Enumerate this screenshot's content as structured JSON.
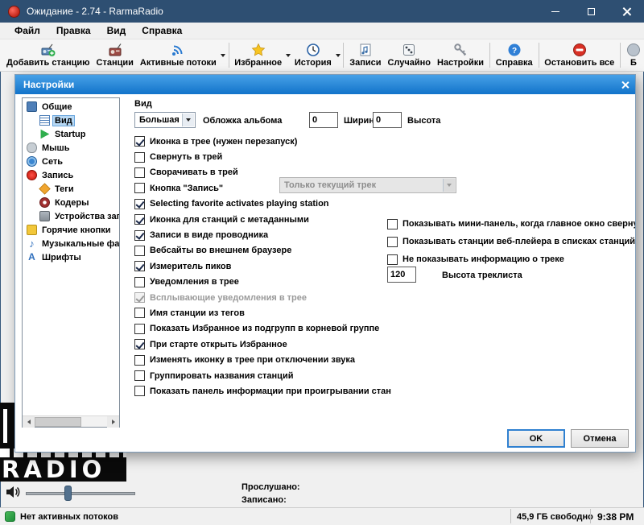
{
  "window": {
    "title": "Ожидание - 2.74 - RarmaRadio",
    "menu": [
      "Файл",
      "Правка",
      "Вид",
      "Справка"
    ],
    "toolbar_groups": [
      [
        {
          "icon": "add-station",
          "label": "Добавить станцию"
        },
        {
          "icon": "stations",
          "label": "Станции"
        },
        {
          "icon": "active-streams",
          "label": "Активные потоки",
          "dropdown": true
        }
      ],
      [
        {
          "icon": "favorites",
          "label": "Избранное",
          "dropdown": true
        },
        {
          "icon": "history",
          "label": "История",
          "dropdown": true
        }
      ],
      [
        {
          "icon": "recordings",
          "label": "Записи"
        },
        {
          "icon": "random",
          "label": "Случайно"
        },
        {
          "icon": "settings",
          "label": "Настройки"
        }
      ],
      [
        {
          "icon": "help",
          "label": "Справка"
        }
      ],
      [
        {
          "icon": "stop-all",
          "label": "Остановить все"
        }
      ],
      [
        {
          "icon": "blocked",
          "label": "Б"
        }
      ]
    ]
  },
  "dialog": {
    "title": "Настройки",
    "tree": [
      {
        "icon": "general",
        "label": "Общие",
        "level": 0
      },
      {
        "icon": "view",
        "label": "Вид",
        "level": 1,
        "selected": true
      },
      {
        "icon": "startup",
        "label": "Startup",
        "level": 1
      },
      {
        "icon": "mouse",
        "label": "Мышь",
        "level": 0
      },
      {
        "icon": "network",
        "label": "Сеть",
        "level": 0
      },
      {
        "icon": "record",
        "label": "Запись",
        "level": 0
      },
      {
        "icon": "tags",
        "label": "Теги",
        "level": 1
      },
      {
        "icon": "encoders",
        "label": "Кодеры",
        "level": 1
      },
      {
        "icon": "devices",
        "label": "Устройства запи",
        "level": 1
      },
      {
        "icon": "hotkeys",
        "label": "Горячие кнопки",
        "level": 0
      },
      {
        "icon": "music",
        "label": "Музыкальные фай",
        "level": 0
      },
      {
        "icon": "fonts",
        "label": "Шрифты",
        "level": 0
      }
    ],
    "panel": {
      "heading": "Вид",
      "cover_combo": "Большая",
      "cover_label": "Обложка альбома",
      "width_value": "0",
      "width_label": "Ширина",
      "height_value": "0",
      "height_label": "Высота",
      "record_mode_combo": "Только текущий трек",
      "checkboxes_left": [
        {
          "label": "Иконка в трее (нужен перезапуск)",
          "checked": true
        },
        {
          "label": "Свернуть в трей",
          "checked": false
        },
        {
          "label": "Сворачивать в трей",
          "checked": false
        },
        {
          "label": "Кнопка \"Запись\"",
          "checked": false
        },
        {
          "label": "Selecting favorite activates playing station",
          "checked": true
        },
        {
          "label": "Иконка для станций с метаданными",
          "checked": true
        },
        {
          "label": "Записи в виде проводника",
          "checked": true
        },
        {
          "label": "Вебсайты во внешнем браузере",
          "checked": false
        },
        {
          "label": "Измеритель пиков",
          "checked": true
        },
        {
          "label": "Уведомления в трее",
          "checked": false
        },
        {
          "label": "Всплывающие уведомления в трее",
          "checked": true,
          "disabled": true
        },
        {
          "label": "Имя станции из тегов",
          "checked": false
        },
        {
          "label": "Показать Избранное из подгрупп в корневой группе",
          "checked": false
        },
        {
          "label": "При старте открыть Избранное",
          "checked": true
        },
        {
          "label": "Изменять иконку в трее при отключении звука",
          "checked": false
        },
        {
          "label": "Группировать названия станций",
          "checked": false
        },
        {
          "label": "Показать панель информации при проигрывании стан",
          "checked": false
        }
      ],
      "checkboxes_right": [
        {
          "label": "Показывать мини-панель, когда главное окно свернут",
          "checked": false
        },
        {
          "label": "Показывать станции веб-плейера в списках станций",
          "checked": false
        },
        {
          "label": "Не показывать информацию о треке",
          "checked": false
        }
      ],
      "tracklist_height_value": "120",
      "tracklist_height_label": "Высота треклиста",
      "ok_label": "OK",
      "cancel_label": "Отмена"
    }
  },
  "player": {
    "album_text": "RADIO",
    "listened_label": "Прослушано:",
    "recorded_label": "Записано:"
  },
  "statusbar": {
    "status": "Нет активных потоков",
    "free_space": "45,9 ГБ свободно",
    "time": "9:38 PM"
  }
}
